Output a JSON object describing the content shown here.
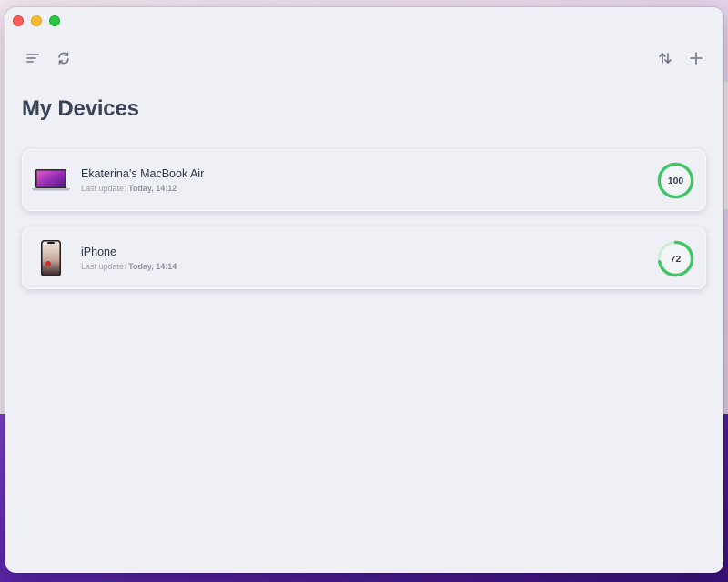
{
  "page": {
    "title": "My Devices"
  },
  "toolbar": {
    "left": [
      {
        "icon": "menu-lines-icon"
      },
      {
        "icon": "refresh-icon"
      }
    ],
    "right": [
      {
        "icon": "sort-arrows-icon"
      },
      {
        "icon": "plus-icon"
      }
    ]
  },
  "devices": [
    {
      "name": "Ekaterina’s MacBook Air",
      "last_update_label": "Last update:",
      "last_update_value": "Today, 14:12",
      "battery": 100,
      "battery_text": "100",
      "icon": "macbook-icon"
    },
    {
      "name": "iPhone",
      "last_update_label": "Last update:",
      "last_update_value": "Today, 14:14",
      "battery": 72,
      "battery_text": "72",
      "icon": "iphone-icon"
    }
  ],
  "colors": {
    "ring_fill": "#3fc764",
    "ring_track": "#cfeed8",
    "title": "#3a4458"
  }
}
